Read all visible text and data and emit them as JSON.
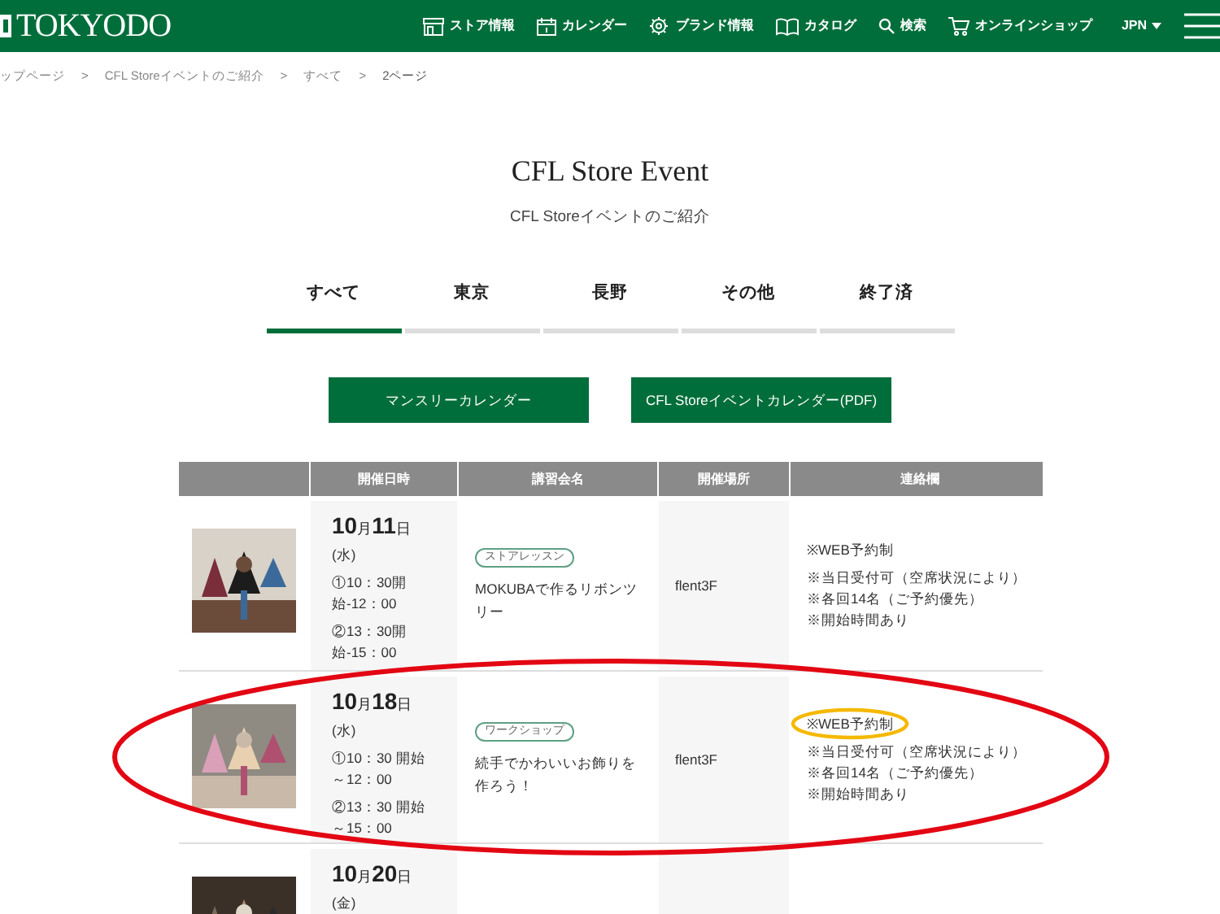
{
  "header": {
    "logo": "TOKYODO",
    "nav": [
      {
        "label": "ストア情報"
      },
      {
        "label": "カレンダー"
      },
      {
        "label": "ブランド情報"
      },
      {
        "label": "カタログ"
      },
      {
        "label": "検索"
      },
      {
        "label": "オンラインショップ"
      }
    ],
    "language": "JPN"
  },
  "breadcrumb": [
    {
      "kind": "link",
      "text": "ップページ"
    },
    {
      "kind": "separator",
      "text": ">"
    },
    {
      "kind": "link",
      "text": "CFL Storeイベントのご紹介"
    },
    {
      "kind": "separator",
      "text": ">"
    },
    {
      "kind": "link",
      "text": "すべて"
    },
    {
      "kind": "separator",
      "text": ">"
    },
    {
      "kind": "current",
      "text": "2ページ"
    }
  ],
  "title": "CFL Store Event",
  "subtitle": "CFL Storeイベントのご紹介",
  "tabs": [
    {
      "label": "すべて",
      "selected": true
    },
    {
      "label": "東京",
      "selected": false
    },
    {
      "label": "長野",
      "selected": false
    },
    {
      "label": "その他",
      "selected": false
    },
    {
      "label": "終了済",
      "selected": false
    }
  ],
  "buttons": [
    "マンスリーカレンダー",
    "CFL Storeイベントカレンダー(PDF)"
  ],
  "table": {
    "columns": [
      "開催日時",
      "講習会名",
      "開催場所",
      "連絡欄"
    ],
    "rows": [
      {
        "date": "10月11日",
        "weekday": "(水)",
        "times": [
          {
            "lines": [
              "①10：30開始-12：00"
            ]
          },
          {
            "lines": [
              "②13：30開始-15：00"
            ]
          }
        ],
        "tag": "ストアレッスン",
        "name": "MOKUBAで作るリボンツリー",
        "place": "flent3F",
        "notes": [
          "※WEB予約制",
          "※当日受付可（空席状況により）",
          "※各回14名（ご予約優先）",
          "※開始時間あり"
        ]
      },
      {
        "date": "10月18日",
        "weekday": "(水)",
        "times": [
          {
            "lines": [
              "①10：30 開始",
              "～12：00"
            ]
          },
          {
            "lines": [
              "②13：30 開始",
              "～15：00"
            ]
          }
        ],
        "tag": "ワークショップ",
        "name": "続手でかわいいお飾りを作ろう！",
        "place": "flent3F",
        "notes": [
          "※WEB予約制",
          "※当日受付可（空席状況により）",
          "※各回14名（ご予約優先）",
          "※開始時間あり"
        ]
      },
      {
        "date": "10月20日",
        "weekday": "(金)"
      }
    ]
  },
  "annotations": [
    {
      "kind": "ellipse",
      "color": "#e30613"
    },
    {
      "kind": "ellipse",
      "color": "#f5b800"
    }
  ]
}
